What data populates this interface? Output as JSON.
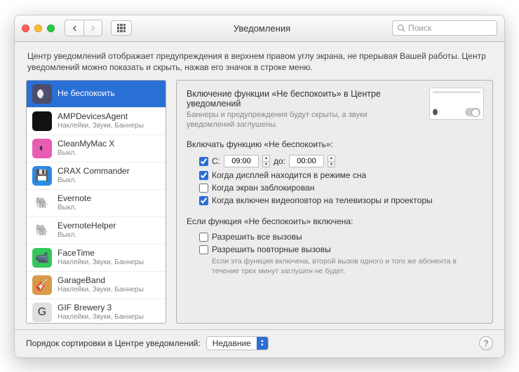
{
  "window": {
    "title": "Уведомления"
  },
  "search": {
    "placeholder": "Поиск"
  },
  "description": "Центр уведомлений отображает предупреждения в верхнем правом углу экрана, не прерывая Вашей работы. Центр уведомлений можно показать и скрыть, нажав его значок в строке меню.",
  "sidebar": {
    "items": [
      {
        "label": "Не беспокоить",
        "sub": "",
        "selected": true,
        "icon_bg": "#4d4d6a",
        "icon": "moon"
      },
      {
        "label": "AMPDevicesAgent",
        "sub": "Наклейки, Звуки, Баннеры",
        "icon_bg": "#111",
        "icon_text": ""
      },
      {
        "label": "CleanMyMac X",
        "sub": "Выкл.",
        "icon_bg": "#e85db3",
        "icon_text": "◐"
      },
      {
        "label": "CRAX Commander",
        "sub": "Выкл.",
        "icon_bg": "#2a8ae6",
        "icon_text": "💾"
      },
      {
        "label": "Evernote",
        "sub": "Выкл.",
        "icon_bg": "#ffffff",
        "icon_text": "🐘"
      },
      {
        "label": "EvernoteHelper",
        "sub": "Выкл.",
        "icon_bg": "#ffffff",
        "icon_text": "🐘"
      },
      {
        "label": "FaceTime",
        "sub": "Наклейки, Звуки, Баннеры",
        "icon_bg": "#34c759",
        "icon_text": "📹"
      },
      {
        "label": "GarageBand",
        "sub": "Наклейки, Звуки, Баннеры",
        "icon_bg": "#d89a4a",
        "icon_text": "🎸"
      },
      {
        "label": "GIF Brewery 3",
        "sub": "Наклейки, Звуки, Баннеры",
        "icon_bg": "#e0e0e0",
        "icon_text": "G"
      }
    ]
  },
  "detail": {
    "heading": "Включение функции «Не беспокоить» в Центре уведомлений",
    "subheading": "Баннеры и предупреждения будут скрыты, а звуки уведомлений заглушены.",
    "enable_label": "Включать функцию «Не беспокоить»:",
    "opts": {
      "time_prefix": "С:",
      "time_from": "09:00",
      "time_mid": "до:",
      "time_to": "00:00",
      "sleep": "Когда дисплей находится в режиме сна",
      "locked": "Когда экран заблокирован",
      "mirror": "Когда включен видеоповтор на телевизоры и проекторы"
    },
    "when_on_label": "Если функция «Не беспокоить» включена:",
    "allow_all": "Разрешить все вызовы",
    "allow_repeat": "Разрешить повторные вызовы",
    "allow_hint": "Если эта функция включена, второй вызов одного и того же абонента в течение трех минут заглушен не будет."
  },
  "footer": {
    "label": "Порядок сортировки в Центре уведомлений:",
    "value": "Недавние"
  }
}
